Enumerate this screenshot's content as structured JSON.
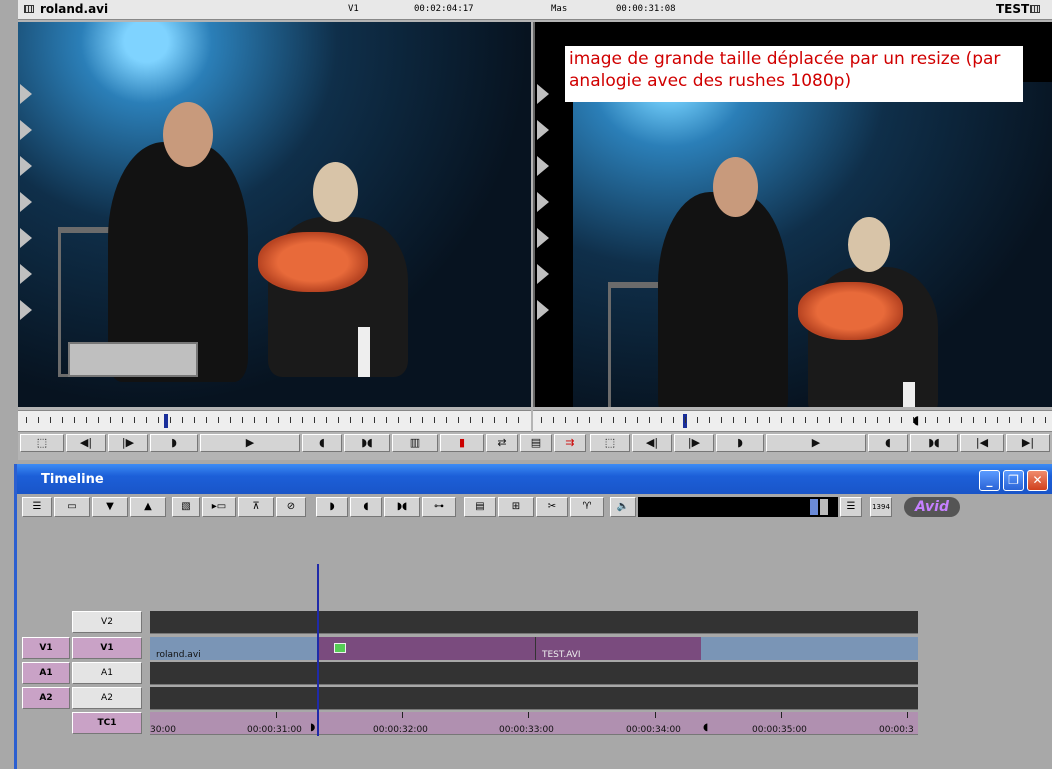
{
  "composer": {
    "clip_name": "roland.avi",
    "source_track": "V1",
    "source_timecode": "00:02:04:17",
    "record_label": "Mas",
    "record_timecode": "00:00:31:08",
    "sequence_name": "TEST",
    "caption": "image de grande taille déplacée par un resize (par analogie avec des rushes 1080p)"
  },
  "timeline": {
    "title": "Timeline",
    "logo": "Avid",
    "firewire_label": "1394",
    "tracks": {
      "v2": "V2",
      "v1_src": "V1",
      "v1": "V1",
      "a1_src": "A1",
      "a1": "A1",
      "a2_src": "A2",
      "a2": "A2",
      "tc1": "TC1"
    },
    "clips": {
      "clip1": "roland.avi",
      "clip2": "TEST.AVI"
    },
    "timecodes": [
      "30:00",
      "00:00:31:00",
      "00:00:32:00",
      "00:00:33:00",
      "00:00:34:00",
      "00:00:35:00",
      "00:00:3"
    ]
  },
  "colors": {
    "title_bar": "#1c5fd8",
    "clip_blue": "#7a95b6",
    "clip_purple": "#7a4b7e",
    "caption_text": "#d00000"
  }
}
